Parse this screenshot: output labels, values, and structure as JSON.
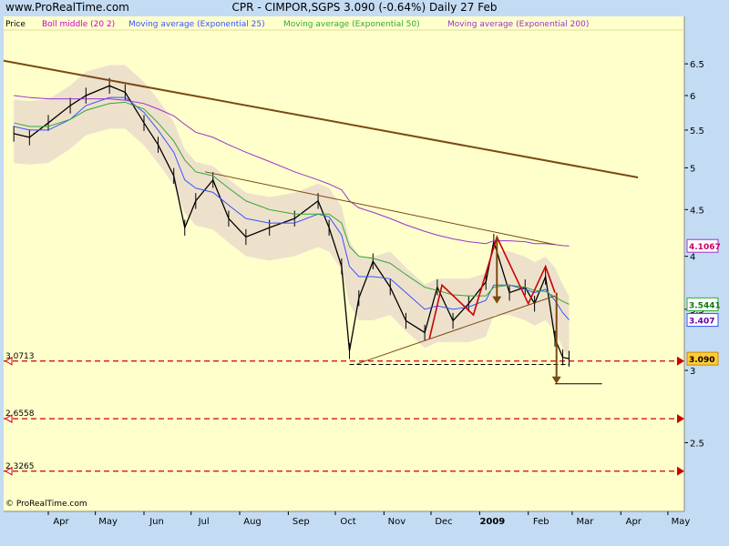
{
  "site": "www.ProRealTime.com",
  "title": "CPR - CIMPOR,SGPS    3.090 (-0.64%)    Daily  27 Feb",
  "footer": "© ProRealTime.com",
  "colors": {
    "background": "#c3dcf3",
    "plot": "#ffffcc",
    "price": "#000000",
    "boll": "#cc00cc",
    "ema25": "#3355ff",
    "ema50": "#33aa33",
    "ema200": "#9933cc",
    "trend": "#7a4a10",
    "pattern": "#cc0000",
    "hline": "#cc0000"
  },
  "chart_data": {
    "type": "line",
    "y_scale": "log",
    "ylim": [
      2.2,
      6.9
    ],
    "y_ticks": [
      "6.5",
      "6",
      "5.5",
      "5",
      "4.5",
      "4",
      "3.5",
      "3",
      "2.5"
    ],
    "x_ticks": [
      "Apr",
      "May",
      "Jun",
      "Jul",
      "Aug",
      "Sep",
      "Oct",
      "Nov",
      "Dec",
      "2009",
      "Feb",
      "Mar",
      "Apr",
      "May"
    ],
    "x": [
      "2008-03-10",
      "2008-03-20",
      "2008-04-01",
      "2008-04-15",
      "2008-04-25",
      "2008-05-10",
      "2008-05-20",
      "2008-06-01",
      "2008-06-10",
      "2008-06-20",
      "2008-06-27",
      "2008-07-04",
      "2008-07-15",
      "2008-07-25",
      "2008-08-05",
      "2008-08-20",
      "2008-09-05",
      "2008-09-20",
      "2008-09-27",
      "2008-10-05",
      "2008-10-10",
      "2008-10-16",
      "2008-10-25",
      "2008-11-05",
      "2008-11-15",
      "2008-11-27",
      "2008-12-05",
      "2008-12-15",
      "2008-12-25",
      "2009-01-05",
      "2009-01-10",
      "2009-01-20",
      "2009-01-30",
      "2009-02-05",
      "2009-02-12",
      "2009-02-18",
      "2009-02-23",
      "2009-02-27"
    ],
    "series": [
      {
        "name": "Price",
        "values": [
          5.45,
          5.4,
          5.6,
          5.85,
          6.0,
          6.15,
          6.05,
          5.6,
          5.3,
          4.9,
          4.3,
          4.6,
          4.85,
          4.4,
          4.2,
          4.3,
          4.4,
          4.6,
          4.3,
          3.9,
          3.15,
          3.6,
          3.95,
          3.7,
          3.4,
          3.3,
          3.7,
          3.4,
          3.55,
          3.75,
          4.15,
          3.65,
          3.7,
          3.55,
          3.8,
          3.25,
          3.1,
          3.09
        ]
      },
      {
        "name": "Boll middle (20 2)",
        "values": [
          5.5,
          5.48,
          5.5,
          5.7,
          5.9,
          6.0,
          6.0,
          5.75,
          5.5,
          5.2,
          4.85,
          4.7,
          4.65,
          4.5,
          4.35,
          4.3,
          4.35,
          4.45,
          4.4,
          4.2,
          3.85,
          3.7,
          3.7,
          3.75,
          3.6,
          3.45,
          3.5,
          3.5,
          3.5,
          3.55,
          3.75,
          3.75,
          3.7,
          3.65,
          3.7,
          3.6,
          3.45,
          3.35
        ]
      },
      {
        "name": "Moving average (Exponential 25)",
        "values": [
          5.55,
          5.5,
          5.5,
          5.65,
          5.85,
          5.97,
          5.97,
          5.75,
          5.5,
          5.2,
          4.85,
          4.75,
          4.7,
          4.55,
          4.4,
          4.35,
          4.35,
          4.45,
          4.42,
          4.22,
          3.9,
          3.8,
          3.8,
          3.78,
          3.65,
          3.5,
          3.53,
          3.5,
          3.52,
          3.58,
          3.72,
          3.72,
          3.68,
          3.65,
          3.68,
          3.58,
          3.47,
          3.407
        ]
      },
      {
        "name": "Moving average (Exponential 50)",
        "values": [
          5.6,
          5.55,
          5.55,
          5.65,
          5.78,
          5.88,
          5.9,
          5.8,
          5.6,
          5.35,
          5.1,
          4.95,
          4.9,
          4.75,
          4.6,
          4.5,
          4.45,
          4.45,
          4.45,
          4.35,
          4.1,
          4.0,
          3.98,
          3.93,
          3.82,
          3.7,
          3.67,
          3.63,
          3.62,
          3.62,
          3.7,
          3.72,
          3.7,
          3.67,
          3.66,
          3.61,
          3.57,
          3.5441
        ]
      },
      {
        "name": "Moving average (Exponential 200)",
        "values": [
          6.0,
          5.97,
          5.95,
          5.95,
          5.95,
          5.95,
          5.93,
          5.88,
          5.8,
          5.7,
          5.58,
          5.47,
          5.4,
          5.3,
          5.2,
          5.08,
          4.95,
          4.85,
          4.8,
          4.73,
          4.6,
          4.52,
          4.47,
          4.4,
          4.33,
          4.26,
          4.22,
          4.18,
          4.15,
          4.13,
          4.16,
          4.16,
          4.15,
          4.13,
          4.13,
          4.12,
          4.11,
          4.1067
        ]
      }
    ],
    "last_values": {
      "price": "3.090",
      "ema50": "3.5441",
      "ema25": "3.407",
      "ema200": "4.1067"
    },
    "horizontal_lines": [
      {
        "label": "3.0713",
        "value": 3.0713
      },
      {
        "label": "2.6558",
        "value": 2.6558
      },
      {
        "label": "2.3265",
        "value": 2.3265
      }
    ],
    "legend": [
      "Price",
      "Boll middle (20 2)",
      "Moving average (Exponential 25)",
      "Moving average (Exponential 50)",
      "Moving average (Exponential 200)"
    ],
    "legend_position": "top-left"
  }
}
